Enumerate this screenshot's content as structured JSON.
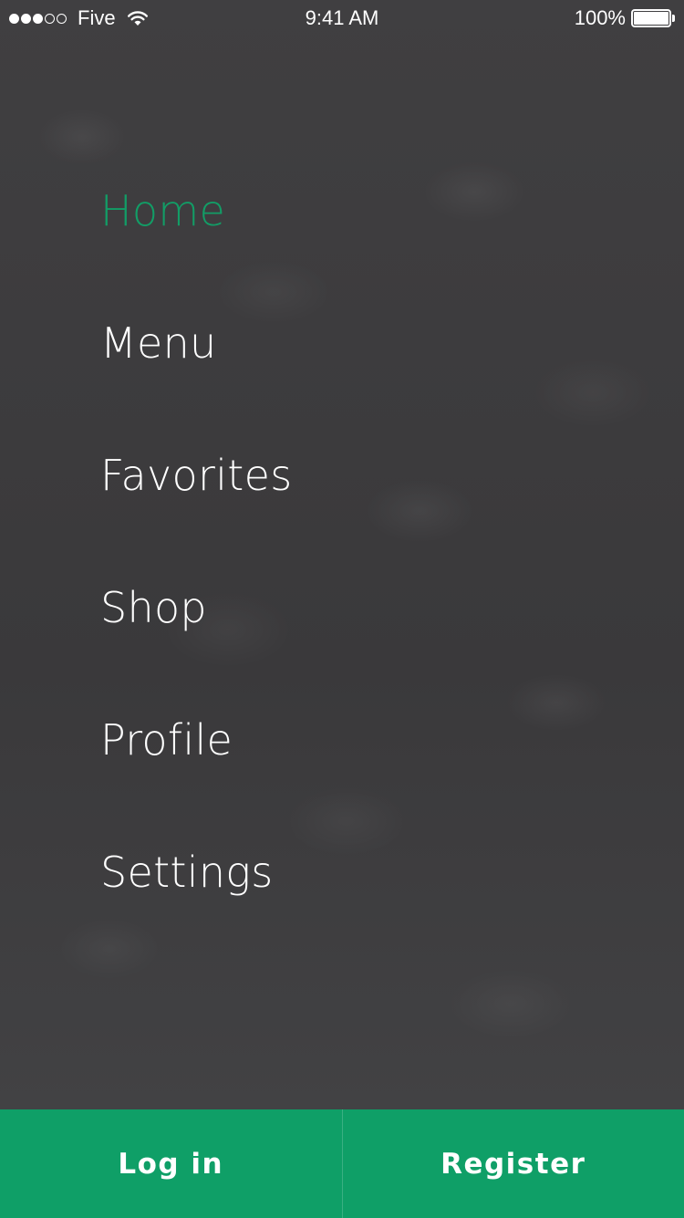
{
  "status_bar": {
    "carrier": "Five",
    "time": "9:41 AM",
    "battery_percent": "100%",
    "battery_level": 1.0,
    "signal_strength_dots_filled": 3,
    "signal_strength_dots_total": 5
  },
  "menu": {
    "items": [
      {
        "label": "Home",
        "active": true
      },
      {
        "label": "Menu",
        "active": false
      },
      {
        "label": "Favorites",
        "active": false
      },
      {
        "label": "Shop",
        "active": false
      },
      {
        "label": "Profile",
        "active": false
      },
      {
        "label": "Settings",
        "active": false
      }
    ]
  },
  "footer": {
    "login_label": "Log in",
    "register_label": "Register"
  },
  "colors": {
    "accent": "#0f9f67",
    "active_text": "#129d66",
    "menu_text": "#ffffff",
    "background": "#3d3d3f"
  }
}
